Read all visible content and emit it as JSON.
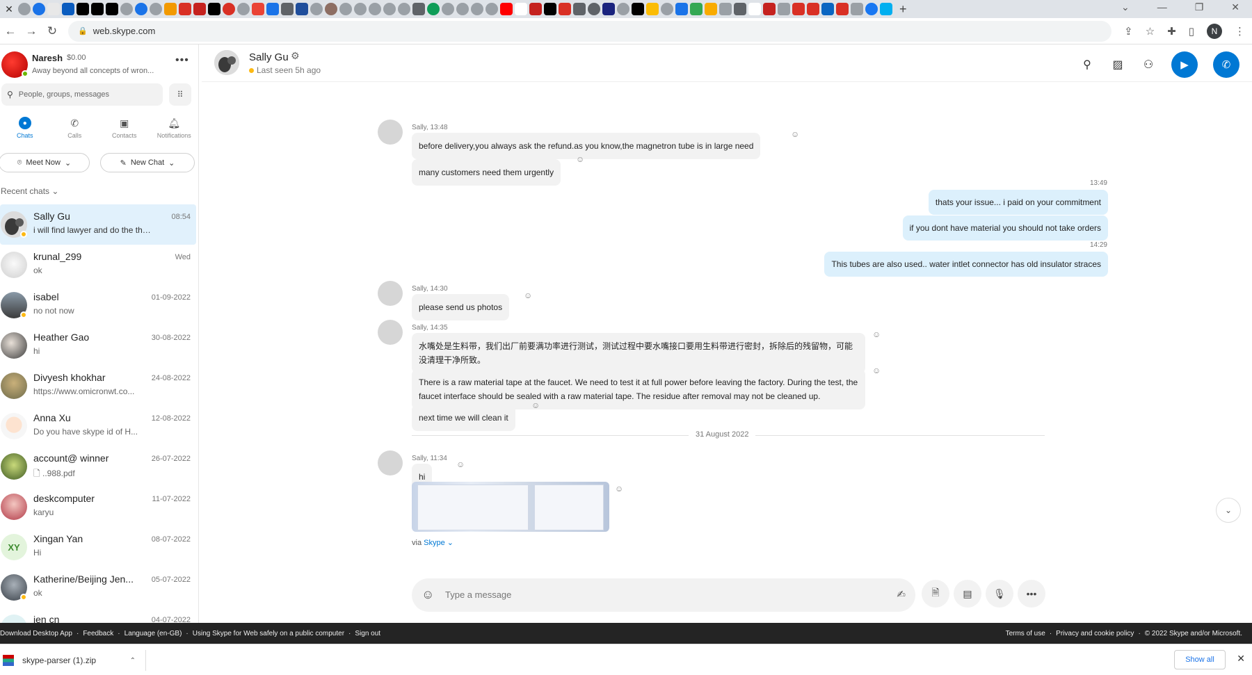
{
  "browser": {
    "url": "web.skype.com",
    "new_tab": "+"
  },
  "profile": {
    "name": "Naresh",
    "credit": "$0.00",
    "status": "Away beyond all concepts of wron...",
    "browser_profile_initial": "N"
  },
  "search": {
    "placeholder": "People, groups, messages"
  },
  "nav_tabs": [
    {
      "label": "Chats",
      "icon": "chat-icon"
    },
    {
      "label": "Calls",
      "icon": "phone-icon"
    },
    {
      "label": "Contacts",
      "icon": "contacts-icon"
    },
    {
      "label": "Notifications",
      "icon": "bell-icon"
    }
  ],
  "actions": {
    "meet_now": "Meet Now",
    "new_chat": "New Chat"
  },
  "recent_chats_label": "Recent chats",
  "chats": [
    {
      "name": "Sally Gu",
      "preview": "i will find lawyer and do the the ...",
      "time": "08:54",
      "active": true
    },
    {
      "name": "krunal_299",
      "preview": "ok",
      "time": "Wed"
    },
    {
      "name": "isabel",
      "preview": "no not now",
      "time": "01-09-2022"
    },
    {
      "name": "Heather Gao",
      "preview": "hi",
      "time": "30-08-2022"
    },
    {
      "name": "Divyesh khokhar",
      "preview": "https://www.omicronwt.co...",
      "time": "24-08-2022"
    },
    {
      "name": "Anna Xu",
      "preview": "Do you have skype id of H...",
      "time": "12-08-2022"
    },
    {
      "name": "account@ winner",
      "preview": "..988.pdf",
      "time": "26-07-2022"
    },
    {
      "name": "deskcomputer",
      "preview": "karyu",
      "time": "11-07-2022"
    },
    {
      "name": "Xingan  Yan",
      "preview": "Hi",
      "time": "08-07-2022",
      "initials": "XY"
    },
    {
      "name": "Katherine/Beijing Jen...",
      "preview": "ok",
      "time": "05-07-2022"
    },
    {
      "name": "jen cn",
      "preview": "",
      "time": "04-07-2022"
    }
  ],
  "conversation": {
    "name": "Sally Gu",
    "last_seen": "Last seen 5h ago",
    "messages": {
      "g1_sender": "Sally, 13:48",
      "g1_m1": "before delivery,you always ask the refund.as you know,the magnetron tube is in large need",
      "g1_m2": "many customers need them urgently",
      "o1_time": "13:49",
      "o1_m1": "thats your issue... i paid on your commitment",
      "o1_m2": "if you dont have material you should not take orders",
      "o2_time": "14:29",
      "o2_m1": "This tubes are also used.. water intlet connector has old insulator straces",
      "g2_sender": "Sally, 14:30",
      "g2_m1": "please send us photos",
      "g3_sender": "Sally, 14:35",
      "g3_m1": "水嘴处是生料带，我们出厂前要满功率进行测试，测试过程中要水嘴接口要用生料带进行密封，拆除后的残留物，可能没清理干净所致。",
      "g3_m2": "There is a raw material tape at the faucet. We need to test it at full power before leaving the factory. During the test, the faucet interface should be sealed with a raw material tape. The residue after removal may not be cleaned up.",
      "g3_m3": "next time we will clean it",
      "day_divider": "31 August 2022",
      "g4_sender": "Sally, 11:34",
      "g4_m1": "hi",
      "via_prefix": "via",
      "via_link": "Skype"
    }
  },
  "composer": {
    "placeholder": "Type a message"
  },
  "footer": {
    "left": [
      "Download Desktop App",
      "·",
      "Feedback",
      "·",
      "Language (en-GB)",
      "·",
      "Using Skype for Web safely on a public computer",
      "·",
      "Sign out"
    ],
    "right": [
      "Terms of use",
      "·",
      "Privacy and cookie policy",
      "·",
      "© 2022 Skype and/or Microsoft."
    ]
  },
  "downloads": {
    "file": "skype-parser (1).zip",
    "show_all": "Show all"
  },
  "colors": {
    "accent": "#0078d4",
    "incoming_bubble": "#f2f2f2",
    "outgoing_bubble": "#dcf0fc",
    "away": "#fdb913",
    "online": "#6bb700"
  }
}
